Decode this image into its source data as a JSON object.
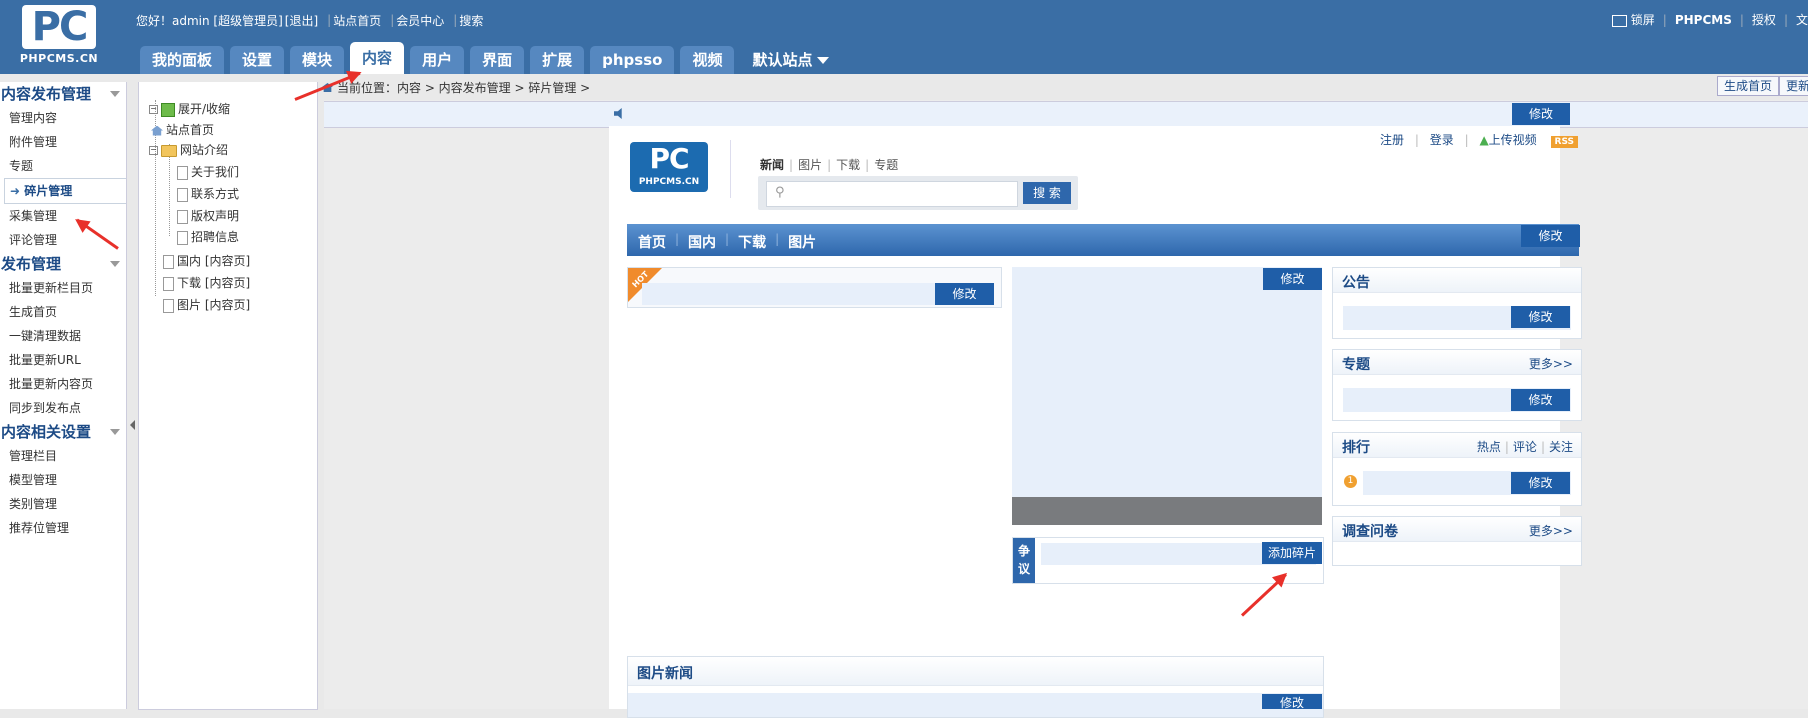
{
  "header": {
    "logo_text": "PHPCMS.CN",
    "logo_pc": "PC",
    "greeting": "您好！admin [超级管理员]",
    "logout": "[退出]",
    "site_home": "站点首页",
    "member_center": "会员中心",
    "search": "搜索",
    "lock_screen": "锁屏",
    "phpcms": "PHPCMS",
    "authorize": "授权",
    "truncated": "文"
  },
  "tabs": [
    "我的面板",
    "设置",
    "模块",
    "内容",
    "用户",
    "界面",
    "扩展",
    "phpsso",
    "视频"
  ],
  "active_tab": "内容",
  "default_site": "默认站点",
  "sidebar": {
    "sections": [
      {
        "title": "内容发布管理",
        "items": [
          "管理内容",
          "附件管理",
          "专题",
          "碎片管理",
          "采集管理",
          "评论管理"
        ]
      },
      {
        "title": "发布管理",
        "items": [
          "批量更新栏目页",
          "生成首页",
          "一键清理数据",
          "批量更新URL",
          "批量更新内容页",
          "同步到发布点"
        ]
      },
      {
        "title": "内容相关设置",
        "items": [
          "管理栏目",
          "模型管理",
          "类别管理",
          "推荐位管理"
        ]
      }
    ],
    "active_item": "碎片管理"
  },
  "tree": {
    "root": "展开/收缩",
    "site_home": "站点首页",
    "intro": "网站介绍",
    "intro_children": [
      "关于我们",
      "联系方式",
      "版权声明",
      "招聘信息"
    ],
    "others": [
      "国内 [内容页]",
      "下载 [内容页]",
      "图片 [内容页]"
    ]
  },
  "breadcrumb": "当前位置：内容 > 内容发布管理 > 碎片管理 >",
  "actions": {
    "gen_home": "生成首页",
    "update": "更新"
  },
  "site": {
    "edit_label": "修改",
    "add_fragment": "添加碎片",
    "register": "注册",
    "login": "登录",
    "upload_video": "上传视频",
    "rss": "RSS",
    "search_tabs": [
      "新闻",
      "图片",
      "下载",
      "专题"
    ],
    "search_button": "搜 索",
    "nav": [
      "首页",
      "国内",
      "下载",
      "图片"
    ],
    "hot": "HOT",
    "dispute": "争议",
    "announcement": "公告",
    "topics": "专题",
    "more": "更多>>",
    "ranking": "排行",
    "rank_tabs": [
      "热点",
      "评论",
      "关注"
    ],
    "rank_num": "1",
    "survey": "调查问卷",
    "photo_news": "图片新闻"
  },
  "colors": {
    "brand": "#3a6ea5",
    "edit_button": "#1f5ea8",
    "arrow": "#e8302a",
    "hot": "#f08b2c"
  }
}
